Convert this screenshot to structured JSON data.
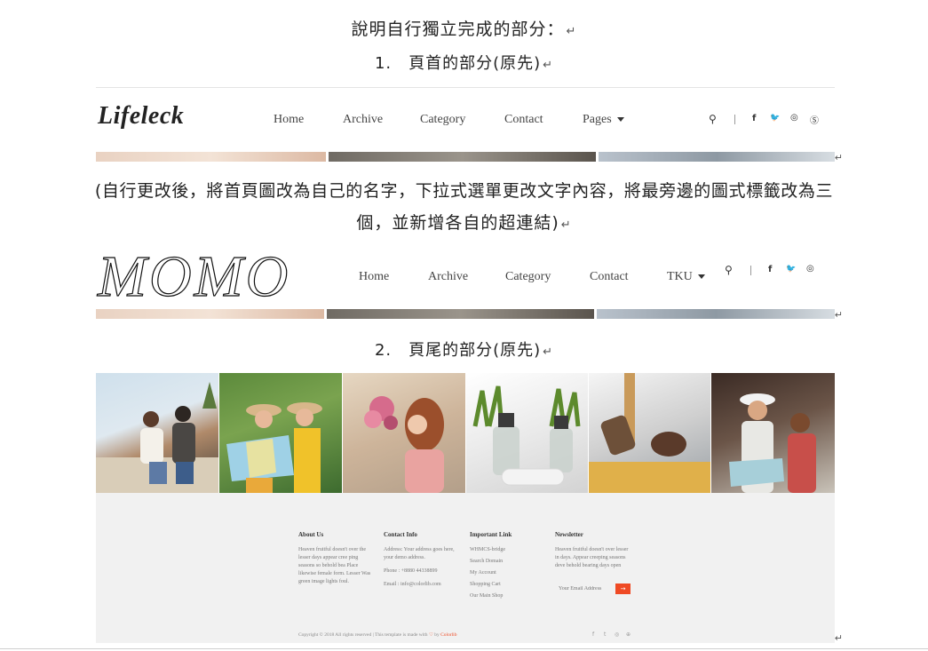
{
  "doc": {
    "heading": "說明自行獨立完成的部分：",
    "section1": "1.　頁首的部分(原先)",
    "change_note_line1": "(自行更改後，將首頁圖改為自己的名字，下拉式選單更改文字內容，將最旁邊的圖式標籤改為三",
    "change_note_line2": "個，並新增各自的超連結)",
    "section2": "2.　頁尾的部分(原先)",
    "para_mark": "↵"
  },
  "header_original": {
    "logo": "Lifeleck",
    "nav": [
      "Home",
      "Archive",
      "Category",
      "Contact",
      "Pages"
    ],
    "icons": [
      "search-icon",
      "facebook-icon",
      "twitter-icon",
      "instagram-icon",
      "skype-icon"
    ]
  },
  "header_modified": {
    "logo": "MOMO",
    "nav": [
      "Home",
      "Archive",
      "Category",
      "Contact",
      "TKU"
    ],
    "icons": [
      "search-icon",
      "facebook-icon",
      "twitter-icon",
      "instagram-icon"
    ]
  },
  "icon_glyphs": {
    "search": "⚲",
    "facebook": "f",
    "twitter": "🐦",
    "instagram": "◎",
    "skype": "Ⓢ"
  },
  "footer": {
    "photos": [
      "travel-couple-photo",
      "map-women-photo",
      "flowers-woman-photo",
      "spray-bottles-photo",
      "grooming-tools-photo",
      "travel-map-couple-photo"
    ],
    "about": {
      "title": "About Us",
      "lines": [
        "Heaven fruitful doesn't over the",
        "lesser days appear cree ping",
        "seasons so behold bea Place",
        "likewise female form. Lesser Was",
        "green image lights foul."
      ]
    },
    "contact": {
      "title": "Contact Info",
      "lines": [
        "Address: Your address goes here,",
        "your demo address.",
        "",
        "Phone : +8880 44338899",
        "",
        "Email : info@colorlib.com"
      ]
    },
    "links": {
      "title": "Important Link",
      "items": [
        "WHMCS-bridge",
        "Search Domain",
        "My Account",
        "Shopping Cart",
        "Our Main Shop"
      ]
    },
    "newsletter": {
      "title": "Newsletter",
      "lines": [
        "Heaven fruitful doesn't over lesser",
        "in days. Appear creeping seasons",
        "deve behold bearing days open"
      ],
      "placeholder": "Your Email Address",
      "button": "→"
    },
    "copyright_pre": "Copyright © 2018 All rights reserved | This template is made with",
    "copyright_heart": "♡",
    "copyright_by": "by",
    "copyright_brand": "Colorlib",
    "social": [
      "f",
      "t",
      "◎",
      "⊕"
    ]
  }
}
